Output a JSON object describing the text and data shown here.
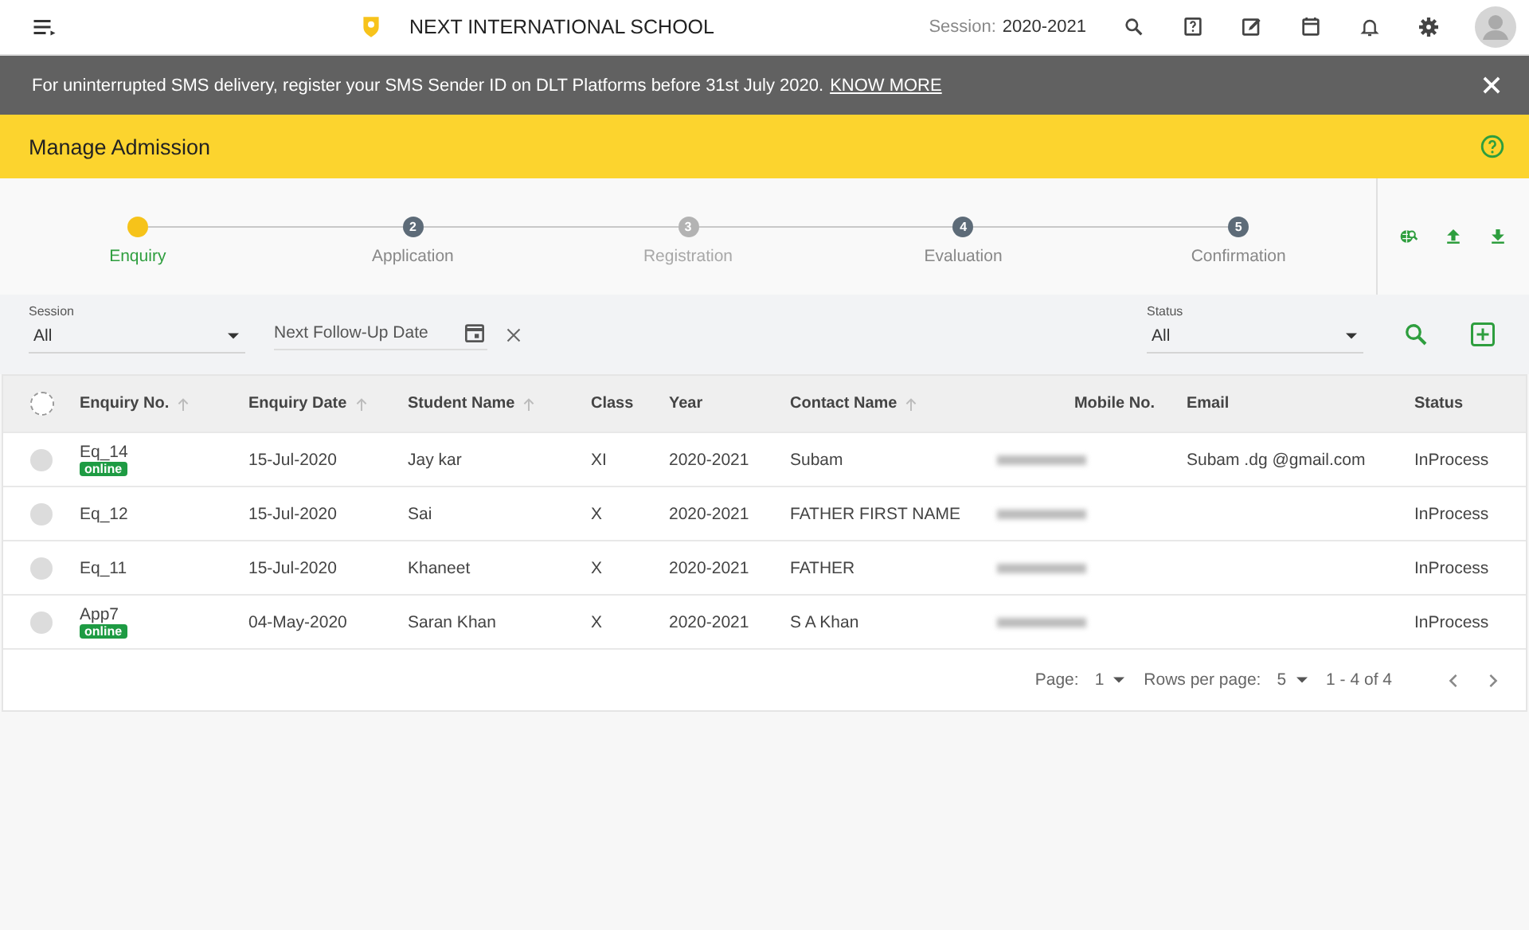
{
  "header": {
    "school_name": "NEXT INTERNATIONAL SCHOOL",
    "session_label": "Session:",
    "session_value": "2020-2021"
  },
  "banner": {
    "message": "For uninterrupted SMS delivery, register your SMS Sender ID on DLT Platforms before 31st July 2020.",
    "link": "KNOW MORE"
  },
  "page_title": "Manage Admission",
  "steps": [
    {
      "label": "Enquiry",
      "current": true,
      "disabled": false
    },
    {
      "number": "2",
      "label": "Application",
      "current": false,
      "disabled": false
    },
    {
      "number": "3",
      "label": "Registration",
      "current": false,
      "disabled": true
    },
    {
      "number": "4",
      "label": "Evaluation",
      "current": false,
      "disabled": false
    },
    {
      "number": "5",
      "label": "Confirmation",
      "current": false,
      "disabled": false
    }
  ],
  "filters": {
    "session": {
      "label": "Session",
      "value": "All"
    },
    "follow_up": {
      "placeholder": "Next Follow-Up Date"
    },
    "status": {
      "label": "Status",
      "value": "All"
    }
  },
  "table": {
    "select_all_checked": false,
    "columns": [
      {
        "label": "Enquiry No.",
        "sort_arrow": true
      },
      {
        "label": "Enquiry Date",
        "sort_arrow": true
      },
      {
        "label": "Student Name",
        "sort_arrow": true
      },
      {
        "label": "Class",
        "sort_arrow": false
      },
      {
        "label": "Year",
        "sort_arrow": false
      },
      {
        "label": "Contact Name",
        "sort_arrow": true
      },
      {
        "label": "Mobile No.",
        "sort_arrow": false
      },
      {
        "label": "Email",
        "sort_arrow": false
      },
      {
        "label": "Status",
        "sort_arrow": false
      }
    ],
    "rows": [
      {
        "selected": false,
        "enquiry_no": "Eq_14",
        "badge": "online",
        "date": "15-Jul-2020",
        "student": "Jay kar",
        "class": "XI",
        "year": "2020-2021",
        "contact": "Subam",
        "email": "Subam .dg @gmail.com",
        "status": "InProcess"
      },
      {
        "selected": false,
        "enquiry_no": "Eq_12",
        "date": "15-Jul-2020",
        "student": "Sai",
        "class": "X",
        "year": "2020-2021",
        "contact": "FATHER FIRST NAME",
        "status": "InProcess"
      },
      {
        "selected": false,
        "enquiry_no": "Eq_11",
        "date": "15-Jul-2020",
        "student": "Khaneet",
        "class": "X",
        "year": "2020-2021",
        "contact": "FATHER",
        "status": "InProcess"
      },
      {
        "selected": false,
        "enquiry_no": "App7",
        "badge": "online",
        "date": "04-May-2020",
        "student": "Saran Khan",
        "class": "X",
        "year": "2020-2021",
        "contact": "S A Khan",
        "status": "InProcess"
      }
    ]
  },
  "pagination": {
    "page_label": "Page:",
    "page": "1",
    "rows_label": "Rows per page:",
    "rows": "5",
    "range": "1 - 4 of 4"
  }
}
